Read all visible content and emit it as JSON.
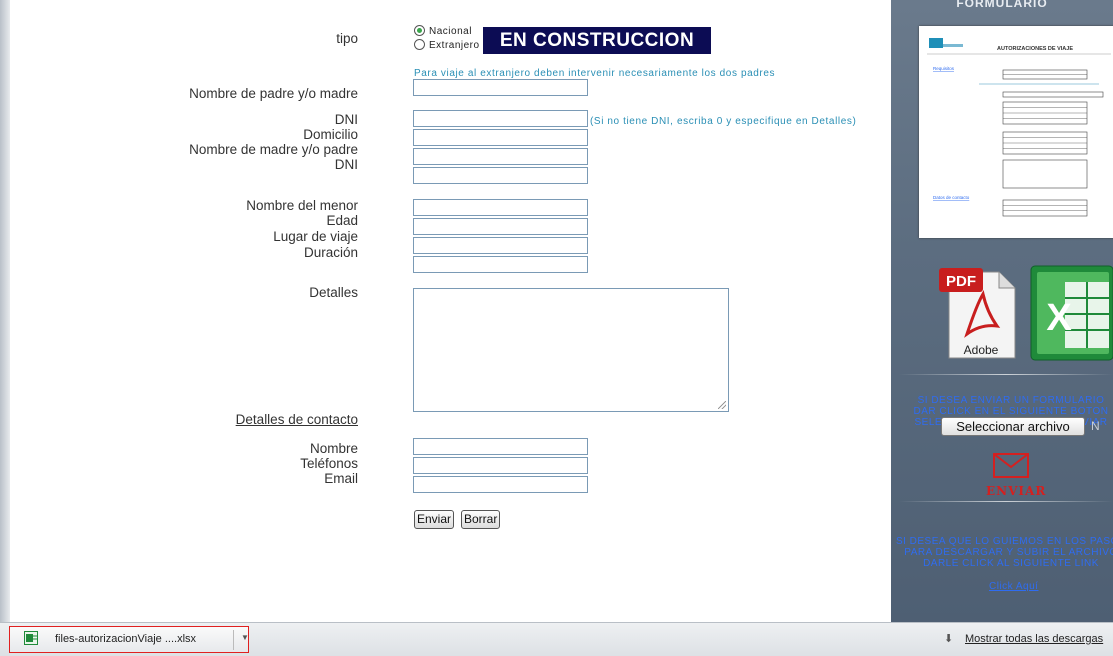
{
  "form": {
    "tipo_label": "tipo",
    "radio_nacional": "Nacional",
    "radio_extranjero": "Extranjero",
    "banner": "EN CONSTRUCCION",
    "note_padres": "Para viaje al extranjero deben intervenir necesariamente los dos padres",
    "padre_label": "Nombre de padre y/o madre",
    "dni1_label": "DNI",
    "dni_note": "(Si no tiene DNI, escriba 0 y especifique en Detalles)",
    "domicilio_label": "Domicilio",
    "madre_label": "Nombre de madre y/o padre",
    "dni2_label": "DNI",
    "menor_label": "Nombre del menor",
    "edad_label": "Edad",
    "lugar_label": "Lugar de viaje",
    "duracion_label": "Duración",
    "detalles_label": "Detalles",
    "contacto_label": "Detalles de contacto",
    "nombre_label": "Nombre",
    "telefonos_label": "Teléfonos",
    "email_label": "Email",
    "enviar_button": "Enviar",
    "borrar_button": "Borrar"
  },
  "sidebar": {
    "title": "FORMULARIO",
    "thumb_title": "AUTORIZACIONES DE VIAJE",
    "thumb_link1": "Requisitos",
    "thumb_link2": "Datos de contacto",
    "pdf_label": "PDF",
    "adobe_label": "Adobe",
    "excel_label": "X",
    "text1": "SI DESEA ENVIAR UN FORMULARIO\nDAR CLICK EN EL SIGUIENTE BOTON\nSELECCIONE SU ARCHIVO Y ENVIAR",
    "file_button": "Seleccionar archivo",
    "file_status": "N",
    "enviar_label": "ENVIAR",
    "text2": "SI DESEA QUE LO GUIEMOS EN LOS PASOS\nPARA DESCARGAR Y SUBIR EL ARCHIVO\nDARLE CLICK AL SIGUIENTE LINK",
    "click_aqui": "Click Aquí"
  },
  "download_bar": {
    "filename": "files-autorizacionViaje ....xlsx",
    "show_all": "Mostrar todas las descargas"
  },
  "colors": {
    "accent_blue": "#2a8fb5",
    "banner_bg": "#0c0c54",
    "sidebar_bg": "#5c6d80",
    "enviar_red": "#d42020"
  }
}
